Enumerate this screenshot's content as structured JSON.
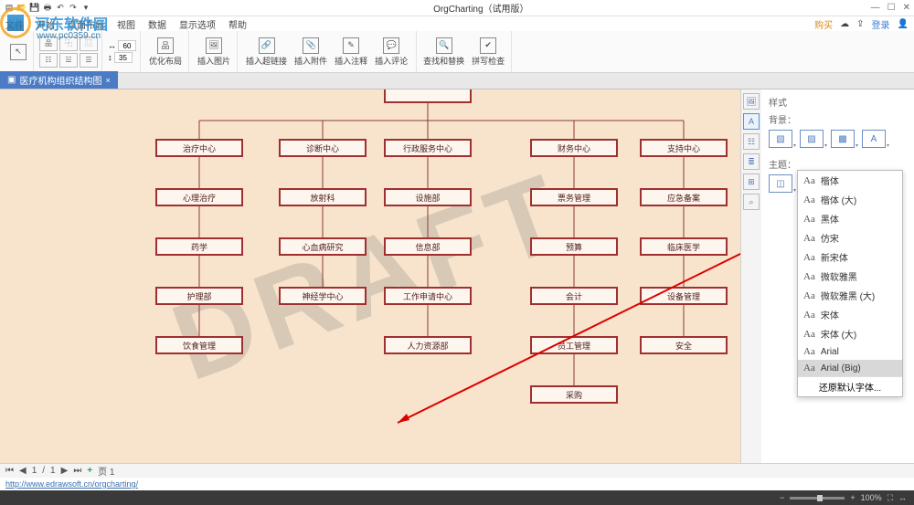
{
  "app": {
    "title": "OrgCharting（试用版）"
  },
  "qat": [
    "新",
    "开",
    "存",
    "印",
    "撤",
    "重",
    "▾"
  ],
  "menu": {
    "items": [
      "文件",
      "开始",
      "页面布局",
      "视图",
      "数据",
      "显示选项",
      "帮助"
    ],
    "right": {
      "buy": "购买",
      "cloud": "☁",
      "share": "⇪",
      "login": "登录",
      "user": "👤"
    }
  },
  "ribbon": {
    "layout_nums": {
      "w": "60",
      "h": "35"
    },
    "buttons": [
      {
        "lbl": "优化布局"
      },
      {
        "lbl": "插入图片"
      },
      {
        "lbl": "插入超链接"
      },
      {
        "lbl": "插入附件"
      },
      {
        "lbl": "插入注释"
      },
      {
        "lbl": "插入评论"
      },
      {
        "lbl": "查找和替换"
      },
      {
        "lbl": "拼写检查"
      }
    ]
  },
  "tab": {
    "name": "医疗机构组织结构图",
    "close": "×"
  },
  "watermark_text": "DRAFT",
  "watermark_logo": {
    "name": "河东软件园",
    "url": "www.pc0359.cn"
  },
  "chart": {
    "root": "",
    "rows": [
      [
        "治疗中心",
        "诊断中心",
        "行政服务中心",
        "财务中心",
        "支持中心"
      ],
      [
        "心理治疗",
        "放射科",
        "设施部",
        "票务管理",
        "应急备案"
      ],
      [
        "药学",
        "心血病研究",
        "信息部",
        "预算",
        "临床医学"
      ],
      [
        "护理部",
        "神经学中心",
        "工作申请中心",
        "会计",
        "设备管理"
      ],
      [
        "饮食管理",
        "",
        "人力资源部",
        "员工管理",
        "安全"
      ],
      [
        "",
        "",
        "",
        "采购",
        ""
      ]
    ],
    "xcols": [
      170,
      305,
      420,
      580,
      700
    ],
    "yrows": [
      54,
      108,
      162,
      216,
      270,
      324
    ]
  },
  "side": {
    "title": "样式",
    "bg_label": "背景：",
    "theme_label": "主题：",
    "tabs": [
      "图",
      "Aa",
      "☷",
      "目",
      "田",
      "⌕"
    ]
  },
  "fontlist": [
    "楷体",
    "楷体 (大)",
    "黑体",
    "仿宋",
    "新宋体",
    "微软雅黑",
    "微软雅黑 (大)",
    "宋体",
    "宋体 (大)",
    "Arial",
    "Arial (Big)"
  ],
  "font_restore": "还原默认字体...",
  "pager": {
    "page_sep": "/",
    "cur": "1",
    "total": "1",
    "pagelbl": "页 1"
  },
  "link": "http://www.edrawsoft.cn/orgcharting/",
  "status": {
    "minus": "−",
    "plus": "+",
    "zoom": "100%"
  }
}
